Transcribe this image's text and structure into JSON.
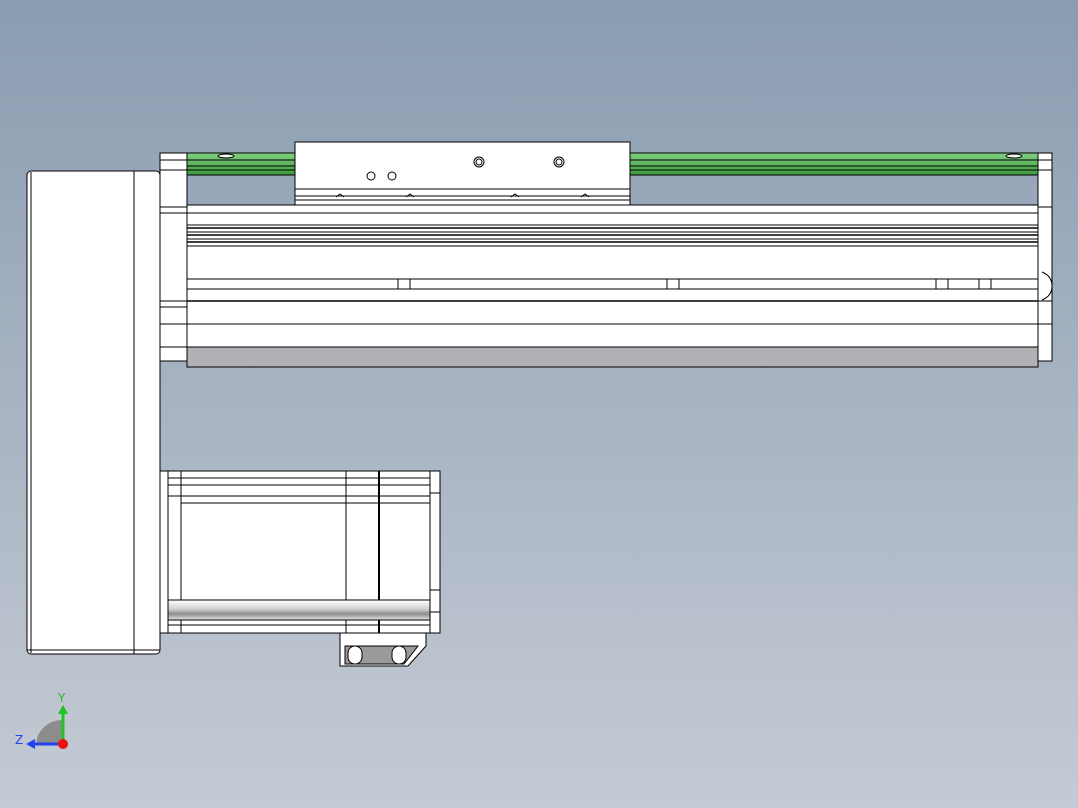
{
  "view": {
    "background": {
      "top": "#8a9cb1",
      "bottom": "#c5cbd4"
    },
    "line_color": "#000000"
  },
  "model": {
    "rail_color": "#5cb85c",
    "body_color": "#ffffff",
    "underside_color": "#b3b0b5",
    "shadow_color": "#9a9a9a"
  },
  "triad": {
    "y_label": "Y",
    "z_label": "Z",
    "y_axis_color": "#22c422",
    "z_axis_color": "#2244ee",
    "origin_color": "#ee1111",
    "arc_color": "#8c8c8c"
  }
}
